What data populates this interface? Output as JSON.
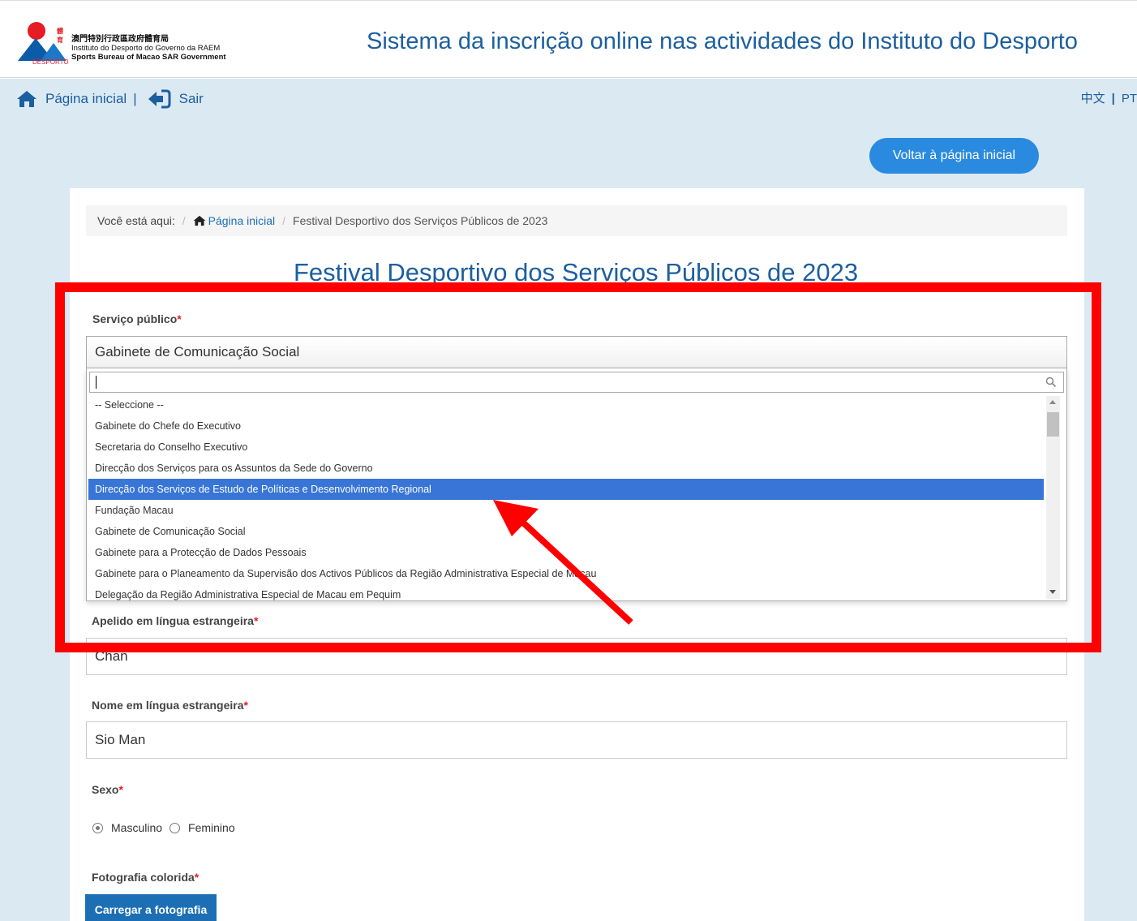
{
  "header": {
    "logo_zh": "澳門特別行政區政府體育局",
    "logo_pt": "Instituto do Desporto do Governo da RAEM",
    "logo_en": "Sports Bureau of Macao SAR Government",
    "logo_mark_small": "體育",
    "logo_mark_label": "DESPORTO",
    "site_title": "Sistema da inscrição online nas actividades do Instituto do Desporto"
  },
  "nav": {
    "home_label": "Página inicial",
    "separator": "|",
    "logout_label": "Sair",
    "lang_zh": "中文",
    "lang_sep": "|",
    "lang_pt": "PT"
  },
  "back_button_label": "Voltar à página inicial",
  "breadcrumb": {
    "prefix": "Você está aqui:",
    "home": "Página inicial",
    "current": "Festival Desportivo dos Serviços Públicos de 2023"
  },
  "page_title": "Festival Desportivo dos Serviços Públicos de 2023",
  "form": {
    "service_label": "Serviço público",
    "required_mark": "*",
    "service_selected": "Gabinete de Comunicação Social",
    "dropdown_search_value": "",
    "dropdown_options": [
      "-- Seleccione --",
      "Gabinete do Chefe do Executivo",
      "Secretaria do Conselho Executivo",
      "Direcção dos Serviços para os Assuntos da Sede do Governo",
      "Direcção dos Serviços de Estudo de Políticas e Desenvolvimento Regional",
      "Fundação Macau",
      "Gabinete de Comunicação Social",
      "Gabinete para a Protecção de Dados Pessoais",
      "Gabinete para o Planeamento da Supervisão dos Activos Públicos da Região Administrativa Especial de Macau",
      "Delegação da Região Administrativa Especial de Macau em Pequim"
    ],
    "highlighted_option_index": 4,
    "surname_label": "Apelido em língua estrangeira",
    "surname_value": "Chan",
    "name_label": "Nome em língua estrangeira",
    "name_value": "Sio Man",
    "sex_label": "Sexo",
    "sex_options": [
      "Masculino",
      "Feminino"
    ],
    "sex_selected": "Masculino",
    "photo_label": "Fotografia colorida",
    "upload_button": "Carregar a fotografia"
  },
  "colors": {
    "brand_blue": "#1c5fa0",
    "button_blue": "#2a8ae0",
    "highlight_option": "#3875d7",
    "annotation_red": "#ff0000",
    "page_bg": "#dbe9f3"
  }
}
